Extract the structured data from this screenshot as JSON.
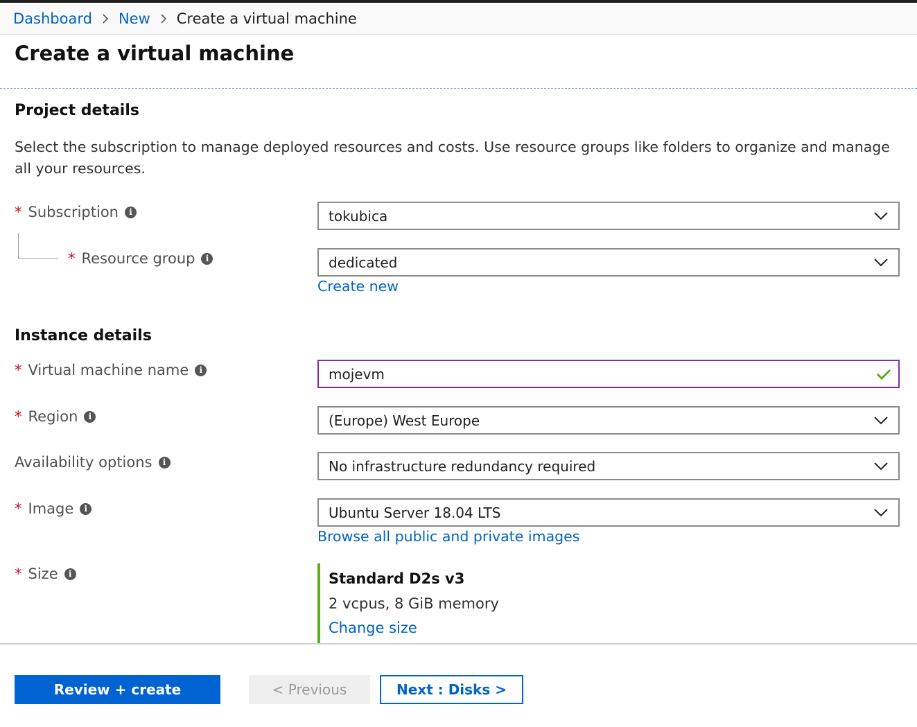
{
  "breadcrumb": {
    "items": [
      "Dashboard",
      "New"
    ],
    "current": "Create a virtual machine"
  },
  "page": {
    "title": "Create a virtual machine"
  },
  "project_details": {
    "heading": "Project details",
    "description": "Select the subscription to manage deployed resources and costs. Use resource groups like folders to organize and manage all your resources.",
    "subscription": {
      "label": "Subscription",
      "value": "tokubica"
    },
    "resource_group": {
      "label": "Resource group",
      "value": "dedicated",
      "create_new": "Create new"
    }
  },
  "instance_details": {
    "heading": "Instance details",
    "vm_name": {
      "label": "Virtual machine name",
      "value": "mojevm"
    },
    "region": {
      "label": "Region",
      "value": "(Europe) West Europe"
    },
    "availability": {
      "label": "Availability options",
      "value": "No infrastructure redundancy required"
    },
    "image": {
      "label": "Image",
      "value": "Ubuntu Server 18.04 LTS",
      "browse_link": "Browse all public and private images"
    },
    "size": {
      "label": "Size",
      "name": "Standard D2s v3",
      "spec": "2 vcpus, 8 GiB memory",
      "change_link": "Change size"
    }
  },
  "footer": {
    "review_create": "Review + create",
    "previous": "< Previous",
    "next": "Next : Disks >"
  },
  "icons": {
    "info": "info-icon",
    "chevron": "chevron-down-icon",
    "valid": "checkmark-icon",
    "separator": "chevron-right-icon"
  },
  "colors": {
    "link": "#0063c1",
    "primary": "#0063d1",
    "required": "#c50f1f",
    "valid": "#5aae1a",
    "focus_border": "#8a2aa0"
  }
}
